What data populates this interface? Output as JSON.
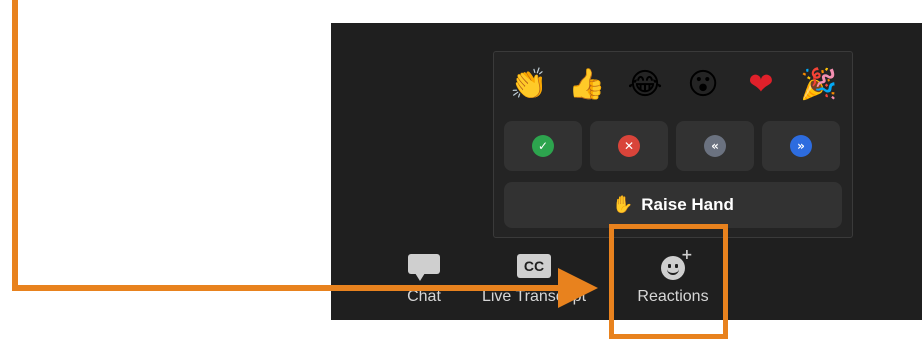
{
  "reactions_popup": {
    "emojis": [
      {
        "icon": "clapping-hands",
        "glyph": "👏"
      },
      {
        "icon": "thumbs-up",
        "glyph": "👍"
      },
      {
        "icon": "joy-tears",
        "glyph": "😂"
      },
      {
        "icon": "open-mouth",
        "glyph": "😮"
      },
      {
        "icon": "red-heart",
        "glyph": "❤"
      },
      {
        "icon": "party-popper",
        "glyph": "🎉"
      }
    ],
    "status_buttons": [
      {
        "icon": "yes-check",
        "glyph": "✓",
        "color": "#2da44e"
      },
      {
        "icon": "no-cross",
        "glyph": "✕",
        "color": "#d9443a"
      },
      {
        "icon": "go-slower",
        "glyph": "«",
        "color": "#6b7280"
      },
      {
        "icon": "go-faster",
        "glyph": "»",
        "color": "#2d6cdf"
      }
    ],
    "raise_hand": {
      "icon": "raised-hand",
      "glyph": "✋",
      "label": "Raise Hand"
    }
  },
  "toolbar": {
    "chat": {
      "icon": "chat-bubble",
      "label": "Chat"
    },
    "live_transcript": {
      "icon": "cc-box",
      "cc_text": "CC",
      "label": "Live Transcript"
    },
    "reactions": {
      "icon": "smiley-plus",
      "label": "Reactions"
    }
  },
  "annotation": {
    "highlight_color": "#e8821e"
  }
}
